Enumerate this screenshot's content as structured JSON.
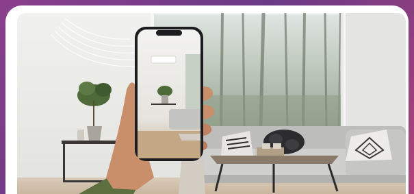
{
  "scene": {
    "description_visible_text": [],
    "colors": {
      "page_background": "#7a3f88",
      "card": "#ffffff",
      "wall": "#e9e9e7",
      "floor": "#d7c8b6",
      "sofa": "#c8c8c8",
      "window_trees": "#9aa89a"
    },
    "icons": {
      "airflow": "airflow-arc-icon",
      "phone": "smartphone-icon"
    }
  }
}
